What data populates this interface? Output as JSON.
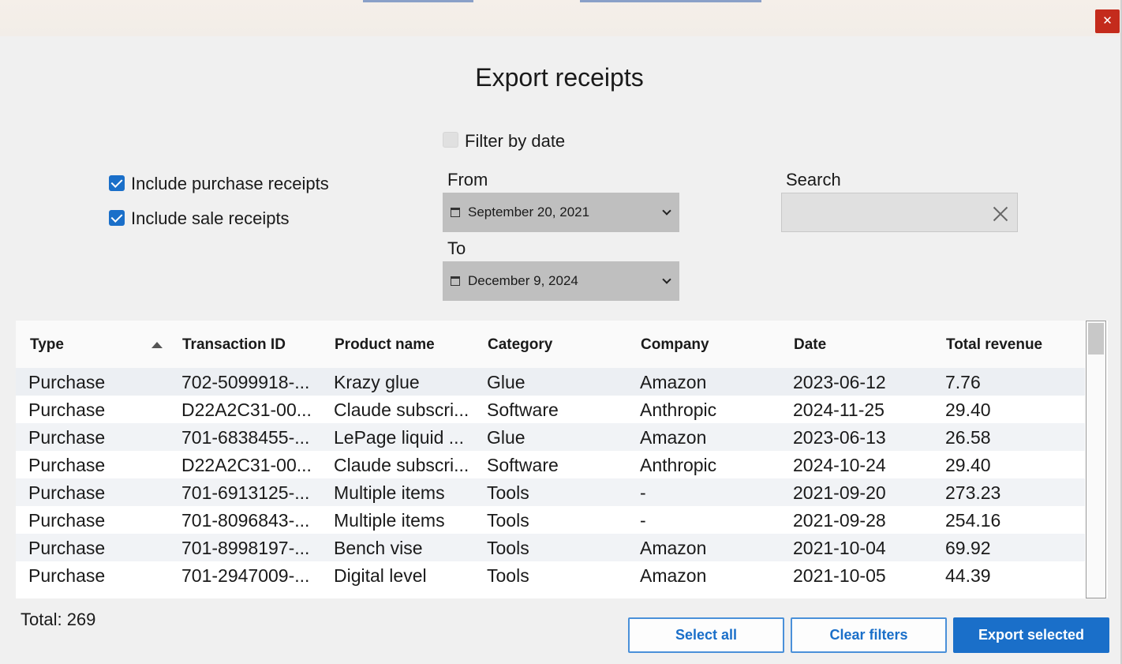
{
  "window": {
    "close_glyph": "✕"
  },
  "dialog": {
    "title": "Export receipts"
  },
  "filters": {
    "include_purchase": {
      "label": "Include purchase receipts",
      "checked": true
    },
    "include_sale": {
      "label": "Include sale receipts",
      "checked": true
    },
    "filter_by_date": {
      "label": "Filter by date",
      "checked": false
    },
    "from_label": "From",
    "from_date": "September 20, 2021",
    "to_label": "To",
    "to_date": "December 9, 2024",
    "search_label": "Search",
    "search_value": ""
  },
  "table": {
    "columns": [
      "Type",
      "Transaction ID",
      "Product name",
      "Category",
      "Company",
      "Date",
      "Total revenue"
    ],
    "sorted_column": "Type",
    "sort_direction": "ascending",
    "rows": [
      [
        "Purchase",
        "702-5099918-...",
        "Krazy glue",
        "Glue",
        "Amazon",
        "2023-06-12",
        "7.76"
      ],
      [
        "Purchase",
        "D22A2C31-00...",
        "Claude subscri...",
        "Software",
        "Anthropic",
        "2024-11-25",
        "29.40"
      ],
      [
        "Purchase",
        "701-6838455-...",
        "LePage liquid ...",
        "Glue",
        "Amazon",
        "2023-06-13",
        "26.58"
      ],
      [
        "Purchase",
        "D22A2C31-00...",
        "Claude subscri...",
        "Software",
        "Anthropic",
        "2024-10-24",
        "29.40"
      ],
      [
        "Purchase",
        "701-6913125-...",
        "Multiple items",
        "Tools",
        "-",
        "2021-09-20",
        "273.23"
      ],
      [
        "Purchase",
        "701-8096843-...",
        "Multiple items",
        "Tools",
        "-",
        "2021-09-28",
        "254.16"
      ],
      [
        "Purchase",
        "701-8998197-...",
        "Bench vise",
        "Tools",
        "Amazon",
        "2021-10-04",
        "69.92"
      ],
      [
        "Purchase",
        "701-2947009-...",
        "Digital level",
        "Tools",
        "Amazon",
        "2021-10-05",
        "44.39"
      ]
    ]
  },
  "footer": {
    "total_text": "Total: 269",
    "select_all_label": "Select all",
    "clear_filters_label": "Clear filters",
    "export_selected_label": "Export selected"
  },
  "colors": {
    "accent": "#1a6fc9",
    "close": "#c42b1c",
    "datepicker_bg": "#bfbfbf"
  }
}
